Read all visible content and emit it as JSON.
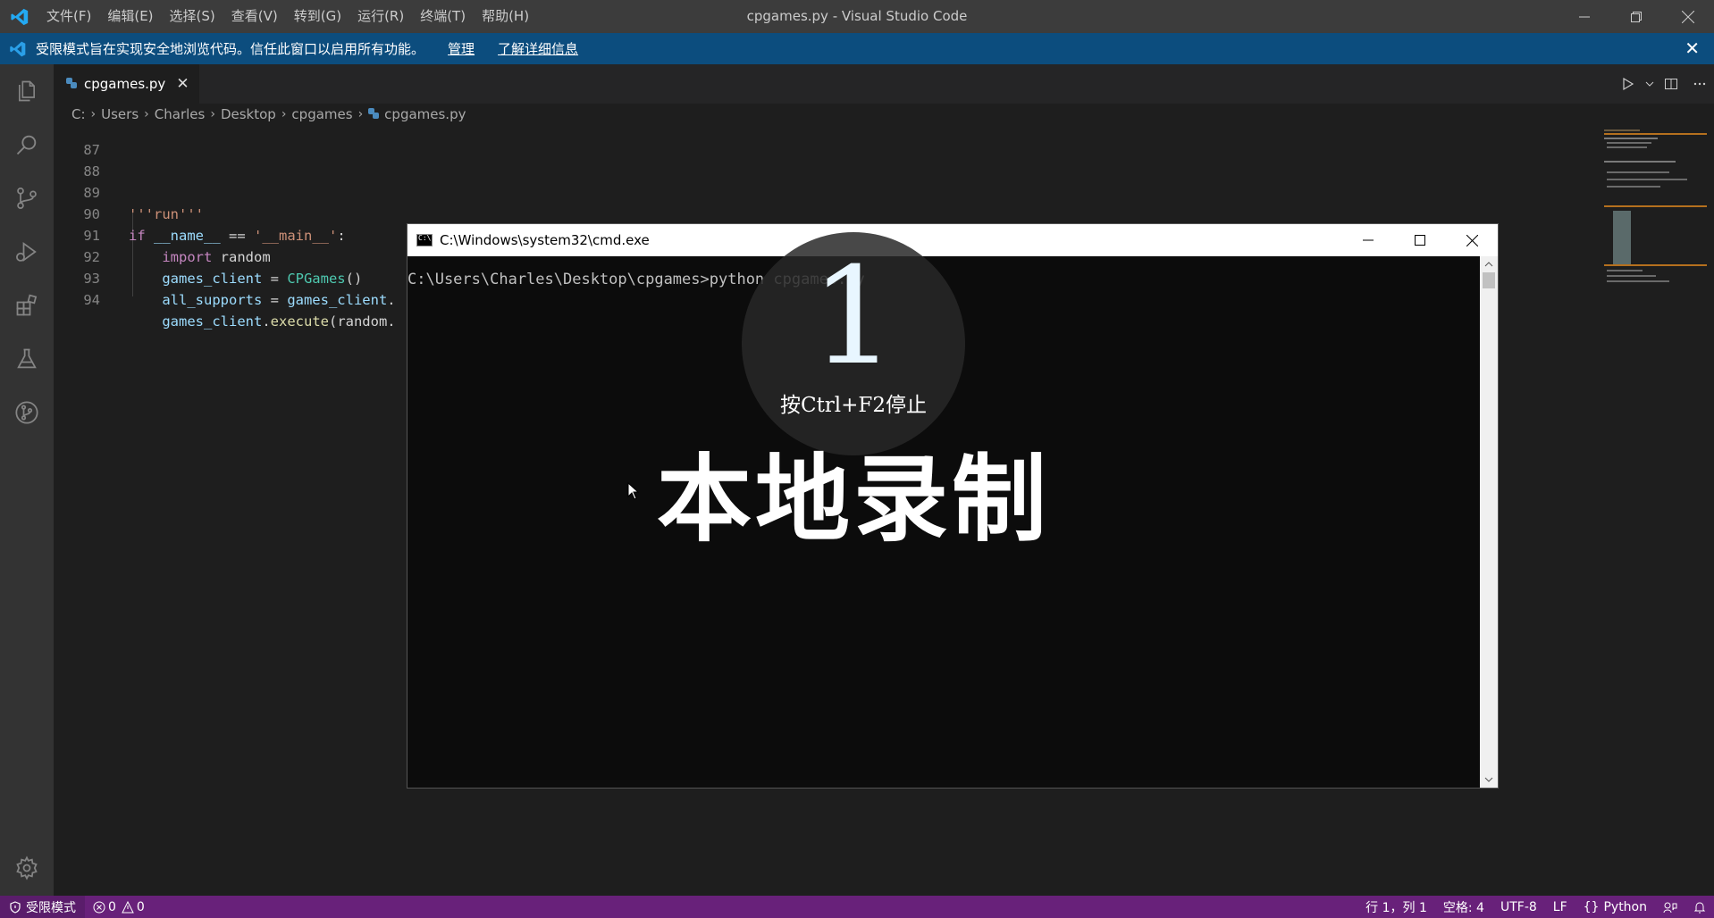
{
  "titlebar": {
    "menus": [
      "文件(F)",
      "编辑(E)",
      "选择(S)",
      "查看(V)",
      "转到(G)",
      "运行(R)",
      "终端(T)",
      "帮助(H)"
    ],
    "window_title": "cpgames.py - Visual Studio Code"
  },
  "banner": {
    "text": "受限模式旨在实现安全地浏览代码。信任此窗口以启用所有功能。",
    "manage": "管理",
    "learn_more": "了解详细信息",
    "close": "✕"
  },
  "tab": {
    "label": "cpgames.py",
    "close": "✕"
  },
  "breadcrumb": [
    "C:",
    "Users",
    "Charles",
    "Desktop",
    "cpgames",
    "cpgames.py"
  ],
  "code_lines": [
    {
      "num": "87"
    },
    {
      "num": "88"
    },
    {
      "num": "89",
      "text": "'''run'''"
    },
    {
      "num": "90",
      "kw": "if",
      "var1": "__name__",
      "op": " == ",
      "str": "'__main__'",
      "end": ":"
    },
    {
      "num": "91",
      "indent": "    ",
      "kw": "import",
      "rest": " random"
    },
    {
      "num": "92",
      "indent": "    ",
      "var": "games_client",
      "op": " = ",
      "cls": "CPGames",
      "end": "()"
    },
    {
      "num": "93",
      "indent": "    ",
      "var": "all_supports",
      "op": " = ",
      "var2": "games_client",
      "end": "."
    },
    {
      "num": "94",
      "indent": "    ",
      "var": "games_client",
      "end": ".",
      "fn": "execute",
      "rest": "(random."
    }
  ],
  "cmd": {
    "title": "C:\\Windows\\system32\\cmd.exe",
    "prompt": "C:\\Users\\Charles\\Desktop\\cpgames>python cpgames.py"
  },
  "overlay": {
    "countdown": "1",
    "stop_hint": "按Ctrl+F2停止",
    "label": "本地录制"
  },
  "statusbar": {
    "restricted": "受限模式",
    "errors": "0",
    "warnings": "0",
    "position": "行 1，列 1",
    "spaces": "空格: 4",
    "encoding": "UTF-8",
    "eol": "LF",
    "language": "Python"
  },
  "colors": {
    "statusbar": "#68217a",
    "banner": "#0c4d7e",
    "titlebar": "#3c3c3c"
  }
}
